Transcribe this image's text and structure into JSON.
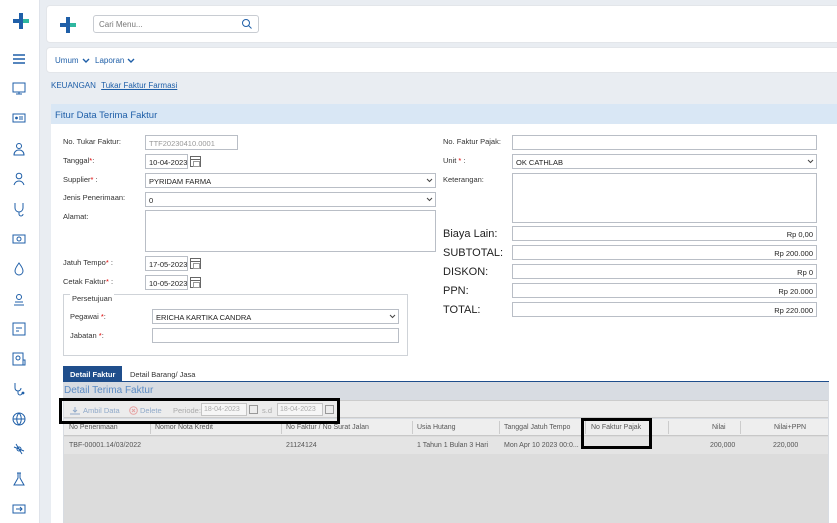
{
  "search": {
    "placeholder": "Cari Menu..."
  },
  "menu": {
    "items": [
      {
        "label": "Umum"
      },
      {
        "label": "Laporan"
      }
    ]
  },
  "breadcrumb": {
    "root": "KEUANGAN",
    "current": "Tukar Faktur Farmasi"
  },
  "panel": {
    "title": "Fitur Data Terima Faktur"
  },
  "form": {
    "no_tukar_faktur": {
      "label": "No. Tukar Faktur:",
      "value": "TTF20230410.0001"
    },
    "tanggal": {
      "label": "Tanggal",
      "req": "*",
      "suffix": ":",
      "value": "10-04-2023"
    },
    "supplier": {
      "label": "Supplier",
      "req": "*",
      "suffix": " :",
      "value": "PYRIDAM FARMA"
    },
    "jenis_penerimaan": {
      "label": "Jenis Penerimaan:",
      "value": "0"
    },
    "alamat": {
      "label": "Alamat:",
      "value": ""
    },
    "jatuh_tempo": {
      "label": "Jatuh Tempo",
      "req": "*",
      "suffix": " :",
      "value": "17-05-2023"
    },
    "cetak_faktur": {
      "label": "Cetak Faktur",
      "req": "*",
      "suffix": " :",
      "value": "10-05-2023"
    },
    "persetujuan": {
      "legend": "Persetujuan"
    },
    "pegawai": {
      "label": "Pegawai ",
      "req": "*",
      "suffix": ":",
      "value": "ERICHA KARTIKA CANDRA"
    },
    "jabatan": {
      "label": "Jabatan ",
      "req": "*",
      "suffix": ":",
      "value": ""
    },
    "no_faktur_pajak": {
      "label": "No. Faktur Pajak:",
      "value": ""
    },
    "unit": {
      "label": "Unit ",
      "req": "*",
      "suffix": " :",
      "value": "OK CATHLAB"
    },
    "keterangan": {
      "label": "Keterangan:",
      "value": ""
    }
  },
  "totals": {
    "biaya_lain": {
      "label": "Biaya Lain:",
      "value": "Rp 0,00"
    },
    "subtotal": {
      "label": "SUBTOTAL:",
      "value": "Rp 200.000"
    },
    "diskon": {
      "label": "DISKON:",
      "value": "Rp 0"
    },
    "ppn": {
      "label": "PPN:",
      "value": "Rp 20.000"
    },
    "total": {
      "label": "TOTAL:",
      "value": "Rp 220.000"
    }
  },
  "tabs": [
    {
      "label": "Detail Faktur",
      "active": true
    },
    {
      "label": "Detail Barang/ Jasa",
      "active": false
    }
  ],
  "detail": {
    "title": "Detail Terima Faktur",
    "toolbar": {
      "ambil_data": "Ambil Data",
      "delete": "Delete",
      "periode_label": "Periode:",
      "periode_from": "18-04-2023",
      "sd_label": "s.d",
      "periode_to": "18-04-2023"
    },
    "columns": [
      "No Penerimaan",
      "Nomor Nota Kredit",
      "No Faktur / No Surat Jalan",
      "Usia Hutang",
      "Tanggal Jatuh Tempo",
      "No Faktur Pajak",
      "Nilai",
      "Nilai+PPN"
    ],
    "rows": [
      [
        "TBF-00001.14/03/2022",
        "",
        "21124124",
        "1 Tahun 1 Bulan 3 Hari",
        "Mon Apr 10 2023 00:0...",
        "",
        "200,000",
        "220,000"
      ]
    ]
  },
  "colors": {
    "primary": "#1f5fa8",
    "tab_active": "#1f4e8c",
    "title_bg": "#d9e7f5",
    "required": "#dd0000"
  },
  "icons": [
    "logo-icon",
    "menu-icon",
    "monitor-icon",
    "id-card-icon",
    "doctor-icon",
    "person-icon",
    "stethoscope-icon",
    "money-icon",
    "drop-icon",
    "nurse-icon",
    "report-icon",
    "user-card-icon",
    "ambulance-icon",
    "globe-icon",
    "medicine-icon",
    "lab-icon",
    "transfer-icon",
    "search-icon",
    "chevron-down-icon",
    "calendar-icon"
  ]
}
